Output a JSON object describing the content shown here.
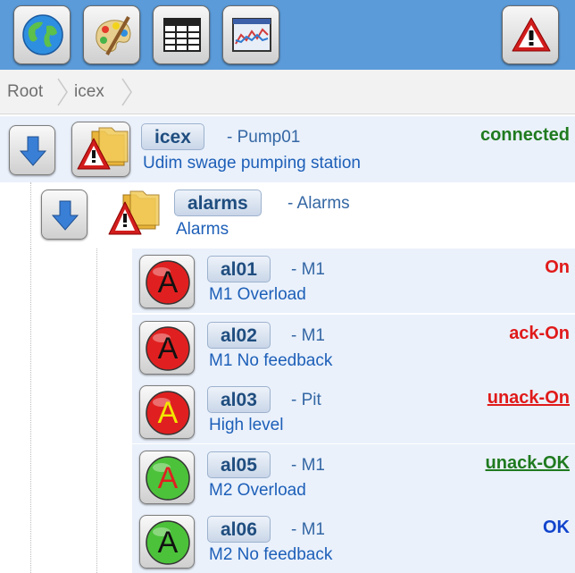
{
  "toolbar": {
    "buttons": [
      {
        "icon": "globe-icon"
      },
      {
        "icon": "palette-icon"
      },
      {
        "icon": "table-icon"
      },
      {
        "icon": "trend-chart-icon"
      },
      {
        "icon": "warning-icon"
      }
    ]
  },
  "breadcrumb": {
    "items": [
      "Root",
      "icex"
    ]
  },
  "tree": {
    "root": {
      "name": "icex",
      "title": "- Pump01",
      "description": "Udim swage pumping station",
      "status": "connected",
      "status_color": "#1f7a1f"
    },
    "folder": {
      "name": "alarms",
      "title": "- Alarms",
      "description": "Alarms"
    },
    "alarms": [
      {
        "name": "al01",
        "title": "- M1",
        "description": "M1 Overload",
        "status": "On",
        "status_color": "#e01a1a",
        "underline": false,
        "letter": "A",
        "bulb": "#e02020",
        "letter_color": "#111111"
      },
      {
        "name": "al02",
        "title": "- M1",
        "description": "M1 No feedback",
        "status": "ack-On",
        "status_color": "#e01a1a",
        "underline": false,
        "letter": "A",
        "bulb": "#e02020",
        "letter_color": "#111111"
      },
      {
        "name": "al03",
        "title": "- Pit",
        "description": "High level",
        "status": "unack-On",
        "status_color": "#e01a1a",
        "underline": true,
        "letter": "A",
        "bulb": "#e02020",
        "letter_color": "#f2e600"
      },
      {
        "name": "al05",
        "title": "- M1",
        "description": "M2 Overload",
        "status": "unack-OK",
        "status_color": "#1f7a1f",
        "underline": true,
        "letter": "A",
        "bulb": "#4cc23a",
        "letter_color": "#e02020"
      },
      {
        "name": "al06",
        "title": "- M1",
        "description": "M2 No feedback",
        "status": "OK",
        "status_color": "#1144cc",
        "underline": false,
        "letter": "A",
        "bulb": "#4cc23a",
        "letter_color": "#111111"
      }
    ]
  }
}
